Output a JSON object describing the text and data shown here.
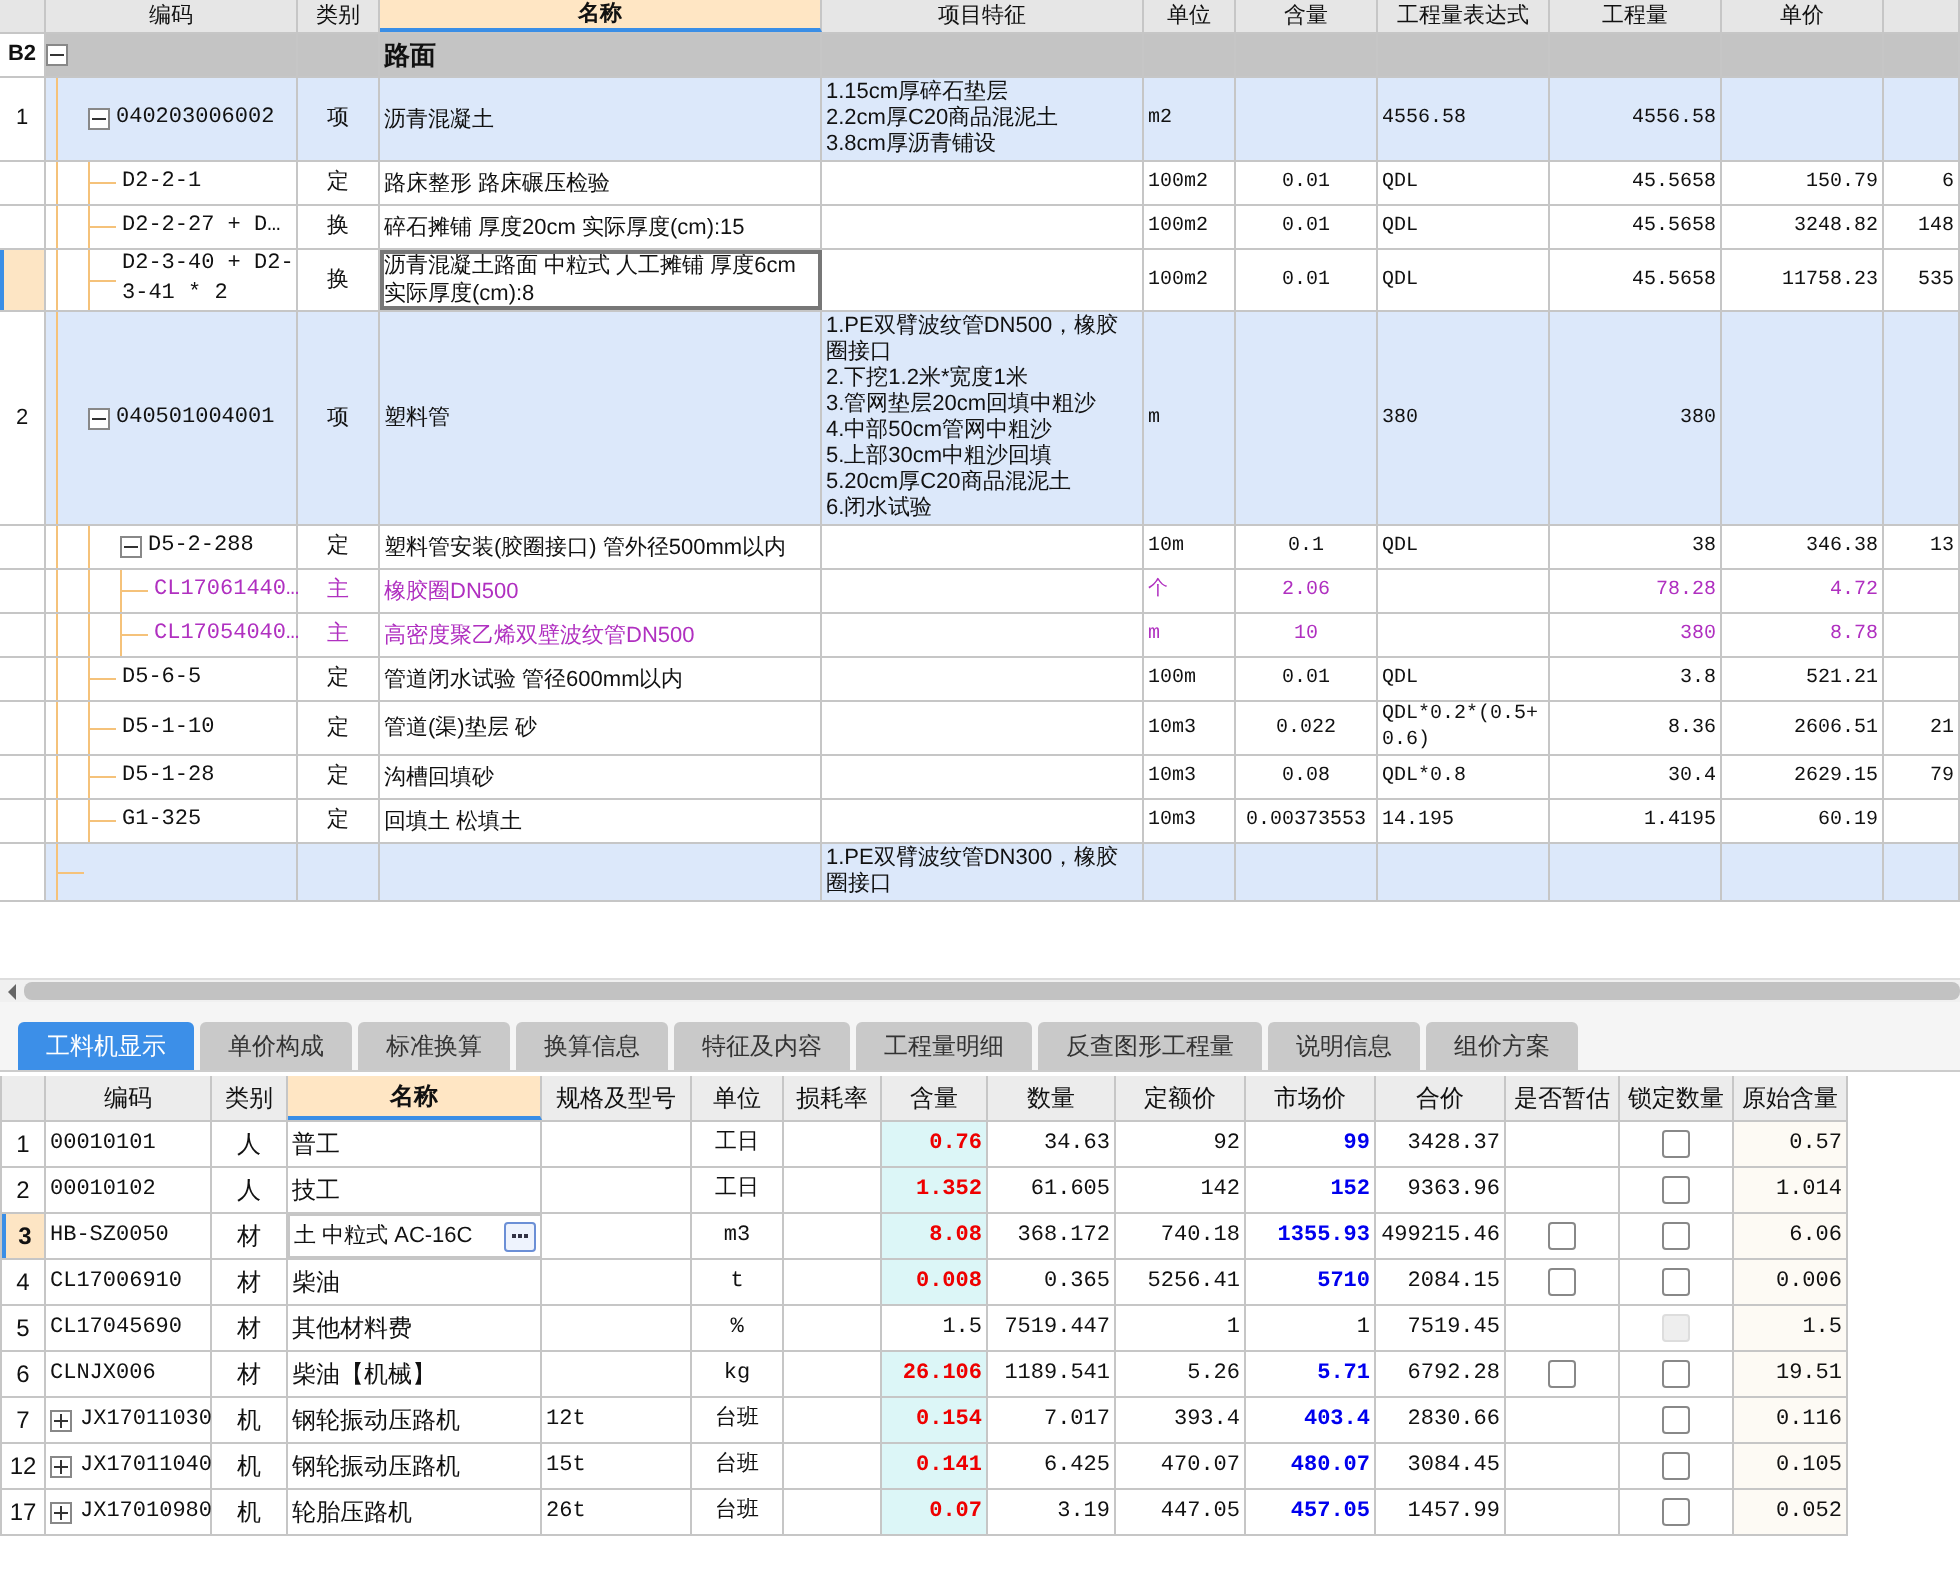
{
  "top_table": {
    "columns": [
      "编码",
      "类别",
      "名称",
      "项目特征",
      "单位",
      "含量",
      "工程量表达式",
      "工程量",
      "单价"
    ],
    "rows": [
      {
        "kind": "group",
        "number": "B2",
        "name": "路面",
        "expanded": true,
        "selected": false,
        "children": [
          {
            "kind": "item",
            "number": "1",
            "code": "040203006002",
            "type": "项",
            "name": "沥青混凝土",
            "features": [
              "1.15cm厚碎石垫层",
              "2.2cm厚C20商品混泥土",
              "3.8cm厚沥青铺设"
            ],
            "unit": "m2",
            "expr": "4556.58",
            "qty": "4556.58",
            "expanded": true,
            "selected": false,
            "children": [
              {
                "kind": "quota",
                "code": "D2-2-1",
                "type": "定",
                "name": "路床整形 路床碾压检验",
                "unit": "100m2",
                "content": "0.01",
                "expr": "QDL",
                "qty": "45.5658",
                "price": "150.79",
                "column_11": "6",
                "selected": false
              },
              {
                "kind": "quota",
                "code": "D2-2-27 + D…",
                "type": "换",
                "name": "碎石摊铺 厚度20cm  实际厚度(cm):15",
                "unit": "100m2",
                "content": "0.01",
                "expr": "QDL",
                "qty": "45.5658",
                "price": "3248.82",
                "column_11": "148",
                "selected": false
              },
              {
                "kind": "quota",
                "code": "D2-3-40 + D2-3-41 * 2",
                "type": "换",
                "name": "沥青混凝土路面 中粒式 人工摊铺 厚度6cm  实际厚度(cm):8",
                "unit": "100m2",
                "content": "0.01",
                "expr": "QDL",
                "qty": "45.5658",
                "price": "11758.23",
                "column_11": "535",
                "selected": true
              }
            ]
          },
          {
            "kind": "item",
            "number": "2",
            "code": "040501004001",
            "type": "项",
            "name": "塑料管",
            "features": [
              "1.PE双臂波纹管DN500，橡胶圈接口",
              "2.下挖1.2米*宽度1米",
              "3.管网垫层20cm回填中粗沙",
              "4.中部50cm管网中粗沙",
              "5.上部30cm中粗沙回填",
              "5.20cm厚C20商品混泥土",
              "6.闭水试验"
            ],
            "unit": "m",
            "expr": "380",
            "qty": "380",
            "expanded": true,
            "selected": false,
            "children": [
              {
                "kind": "quota",
                "code": "D5-2-288",
                "type": "定",
                "name": "塑料管安装(胶圈接口) 管外径500mm以内",
                "unit": "10m",
                "content": "0.1",
                "expr": "QDL",
                "qty": "38",
                "price": "346.38",
                "column_11": "13",
                "expanded": true,
                "selected": false,
                "children": [
                  {
                    "kind": "material",
                    "code": "CL17061440…",
                    "type": "主",
                    "name": "橡胶圈DN500",
                    "unit": "个",
                    "content": "2.06",
                    "qty": "78.28",
                    "price": "4.72",
                    "selected": false
                  },
                  {
                    "kind": "material",
                    "code": "CL17054040…",
                    "type": "主",
                    "name": "高密度聚乙烯双壁波纹管DN500",
                    "unit": "m",
                    "content": "10",
                    "qty": "380",
                    "price": "8.78",
                    "selected": false
                  }
                ]
              },
              {
                "kind": "quota",
                "code": "D5-6-5",
                "type": "定",
                "name": "管道闭水试验 管径600mm以内",
                "unit": "100m",
                "content": "0.01",
                "expr": "QDL",
                "qty": "3.8",
                "price": "521.21",
                "selected": false
              },
              {
                "kind": "quota",
                "code": "D5-1-10",
                "type": "定",
                "name": "管道(渠)垫层 砂",
                "unit": "10m3",
                "content": "0.022",
                "expr": "QDL*0.2*(0.5+0.6)",
                "qty": "8.36",
                "price": "2606.51",
                "column_11": "21",
                "selected": false
              },
              {
                "kind": "quota",
                "code": "D5-1-28",
                "type": "定",
                "name": "沟槽回填砂",
                "unit": "10m3",
                "content": "0.08",
                "expr": "QDL*0.8",
                "qty": "30.4",
                "price": "2629.15",
                "column_11": "79",
                "selected": false
              },
              {
                "kind": "quota",
                "code": "G1-325",
                "type": "定",
                "name": "回填土 松填土",
                "unit": "10m3",
                "content": "0.00373553",
                "expr": "14.195",
                "qty": "1.4195",
                "price": "60.19",
                "selected": false
              }
            ]
          },
          {
            "kind": "item",
            "features": [
              "1.PE双臂波纹管DN300，橡胶圈接口"
            ],
            "selected": false
          }
        ]
      }
    ]
  },
  "tabs": [
    {
      "label": "工料机显示",
      "selected": true
    },
    {
      "label": "单价构成",
      "selected": false
    },
    {
      "label": "标准换算",
      "selected": false
    },
    {
      "label": "换算信息",
      "selected": false
    },
    {
      "label": "特征及内容",
      "selected": false
    },
    {
      "label": "工程量明细",
      "selected": false
    },
    {
      "label": "反查图形工程量",
      "selected": false
    },
    {
      "label": "说明信息",
      "selected": false
    },
    {
      "label": "组价方案",
      "selected": false
    }
  ],
  "bottom_table": {
    "columns": [
      "编码",
      "类别",
      "名称",
      "规格及型号",
      "单位",
      "损耗率",
      "含量",
      "数量",
      "定额价",
      "市场价",
      "合价",
      "是否暂估",
      "锁定数量",
      "原始含量"
    ],
    "rows": [
      {
        "number": "1",
        "code": "00010101",
        "type": "人",
        "name": "普工",
        "unit": "工日",
        "content": "0.76",
        "qty": "34.63",
        "base_price": "92",
        "market_price": "99",
        "total": "3428.37",
        "lock": {
          "checked": false,
          "disabled": false
        },
        "original": "0.57",
        "adjusted": true,
        "selected": false
      },
      {
        "number": "2",
        "code": "00010102",
        "type": "人",
        "name": "技工",
        "unit": "工日",
        "content": "1.352",
        "qty": "61.605",
        "base_price": "142",
        "market_price": "152",
        "total": "9363.96",
        "lock": {
          "checked": false,
          "disabled": false
        },
        "original": "1.014",
        "adjusted": true,
        "selected": false
      },
      {
        "number": "3",
        "code": "HB-SZ0050",
        "type": "材",
        "name": "土 中粒式 AC-16C",
        "unit": "m3",
        "content": "8.08",
        "qty": "368.172",
        "base_price": "740.18",
        "market_price": "1355.93",
        "total": "499215.46",
        "estimate": {
          "checked": false
        },
        "lock": {
          "checked": false,
          "disabled": false
        },
        "original": "6.06",
        "adjusted": true,
        "selected": true
      },
      {
        "number": "4",
        "code": "CL17006910",
        "type": "材",
        "name": "柴油",
        "unit": "t",
        "content": "0.008",
        "qty": "0.365",
        "base_price": "5256.41",
        "market_price": "5710",
        "total": "2084.15",
        "estimate": {
          "checked": false
        },
        "lock": {
          "checked": false,
          "disabled": false
        },
        "original": "0.006",
        "adjusted": true,
        "selected": false
      },
      {
        "number": "5",
        "code": "CL17045690",
        "type": "材",
        "name": "其他材料费",
        "unit": "%",
        "content": "1.5",
        "qty": "7519.447",
        "base_price": "1",
        "market_price": "1",
        "total": "7519.45",
        "lock": {
          "checked": false,
          "disabled": true
        },
        "original": "1.5",
        "adjusted": false,
        "selected": false
      },
      {
        "number": "6",
        "code": "CLNJX006",
        "type": "材",
        "name": "柴油【机械】",
        "unit": "kg",
        "content": "26.106",
        "qty": "1189.541",
        "base_price": "5.26",
        "market_price": "5.71",
        "total": "6792.28",
        "estimate": {
          "checked": false
        },
        "lock": {
          "checked": false,
          "disabled": false
        },
        "original": "19.51",
        "adjusted": true,
        "selected": false
      },
      {
        "number": "7",
        "expanded": false,
        "code": "JX17011030",
        "type": "机",
        "name": "钢轮振动压路机",
        "spec": "12t",
        "unit": "台班",
        "content": "0.154",
        "qty": "7.017",
        "base_price": "393.4",
        "market_price": "403.4",
        "total": "2830.66",
        "lock": {
          "checked": false,
          "disabled": false
        },
        "original": "0.116",
        "adjusted": true,
        "selected": false
      },
      {
        "number": "12",
        "expanded": false,
        "code": "JX17011040",
        "type": "机",
        "name": "钢轮振动压路机",
        "spec": "15t",
        "unit": "台班",
        "content": "0.141",
        "qty": "6.425",
        "base_price": "470.07",
        "market_price": "480.07",
        "total": "3084.45",
        "lock": {
          "checked": false,
          "disabled": false
        },
        "original": "0.105",
        "adjusted": true,
        "selected": false
      },
      {
        "number": "17",
        "expanded": false,
        "code": "JX17010980",
        "type": "机",
        "name": "轮胎压路机",
        "spec": "26t",
        "unit": "台班",
        "content": "0.07",
        "qty": "3.19",
        "base_price": "447.05",
        "market_price": "457.05",
        "total": "1457.99",
        "lock": {
          "checked": false,
          "disabled": false
        },
        "original": "0.052",
        "adjusted": true,
        "selected": false
      }
    ]
  }
}
